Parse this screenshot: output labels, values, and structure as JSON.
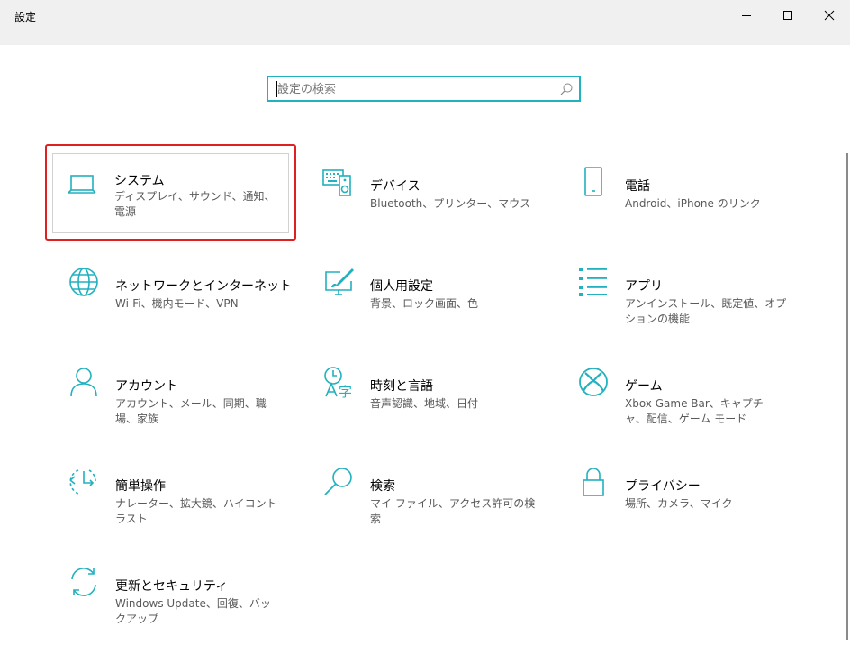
{
  "window": {
    "title": "設定",
    "controls": [
      "minimize",
      "maximize",
      "close"
    ]
  },
  "search": {
    "placeholder": "設定の検索",
    "value": ""
  },
  "accent_color": "#22b1be",
  "selection_color": "#e02020",
  "tiles": [
    {
      "title": "システム",
      "desc": "ディスプレイ、サウンド、通知、電源",
      "icon": "laptop-icon",
      "selected": true
    },
    {
      "title": "デバイス",
      "desc": "Bluetooth、プリンター、マウス",
      "icon": "keyboard-speaker-icon"
    },
    {
      "title": "電話",
      "desc": "Android、iPhone のリンク",
      "icon": "phone-icon"
    },
    {
      "title": "ネットワークとインターネット",
      "desc": "Wi-Fi、機内モード、VPN",
      "icon": "globe-icon"
    },
    {
      "title": "個人用設定",
      "desc": "背景、ロック画面、色",
      "icon": "paint-monitor-icon"
    },
    {
      "title": "アプリ",
      "desc": "アンインストール、既定値、オプションの機能",
      "icon": "apps-list-icon"
    },
    {
      "title": "アカウント",
      "desc": "アカウント、メール、同期、職場、家族",
      "icon": "person-icon"
    },
    {
      "title": "時刻と言語",
      "desc": "音声認識、地域、日付",
      "icon": "time-language-icon"
    },
    {
      "title": "ゲーム",
      "desc": "Xbox Game Bar、キャプチャ、配信、ゲーム モード",
      "icon": "xbox-icon"
    },
    {
      "title": "簡単操作",
      "desc": "ナレーター、拡大鏡、ハイコントラスト",
      "icon": "ease-of-access-icon"
    },
    {
      "title": "検索",
      "desc": "マイ ファイル、アクセス許可の検索",
      "icon": "magnifier-icon"
    },
    {
      "title": "プライバシー",
      "desc": "場所、カメラ、マイク",
      "icon": "lock-icon"
    },
    {
      "title": "更新とセキュリティ",
      "desc": "Windows Update、回復、バックアップ",
      "icon": "sync-icon"
    }
  ]
}
